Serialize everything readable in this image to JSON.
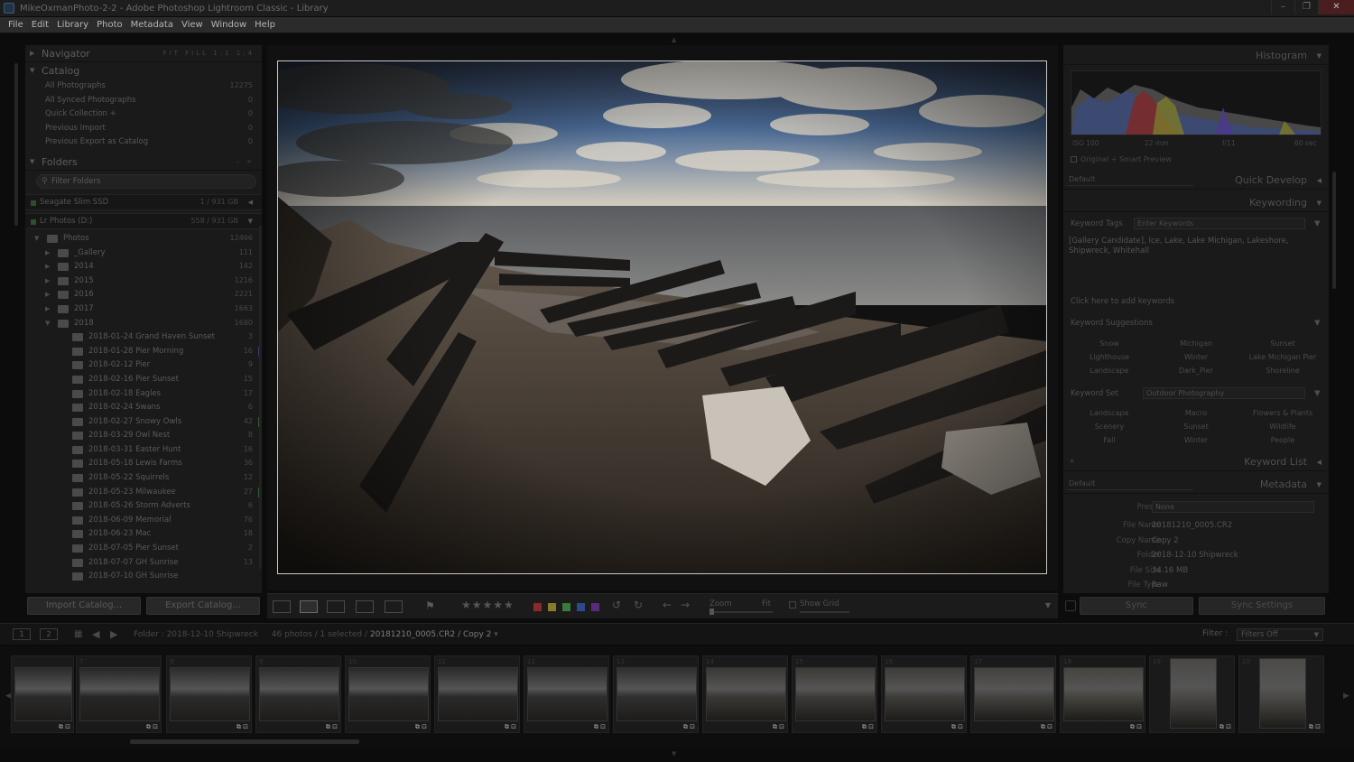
{
  "window": {
    "title": "MikeOxmanPhoto-2-2 - Adobe Photoshop Lightroom Classic - Library",
    "controls": [
      "–",
      "❐",
      "✕"
    ]
  },
  "menu": [
    "File",
    "Edit",
    "Library",
    "Photo",
    "Metadata",
    "View",
    "Window",
    "Help"
  ],
  "left": {
    "navigator": {
      "label": "Navigator",
      "options": "FIT  FILL  1:1  1:4"
    },
    "catalog": {
      "label": "Catalog",
      "items": [
        {
          "label": "All Photographs",
          "count": "12275"
        },
        {
          "label": "All Synced Photographs",
          "count": "0"
        },
        {
          "label": "Quick Collection +",
          "count": "0"
        },
        {
          "label": "Previous Import",
          "count": "0"
        },
        {
          "label": "Previous Export as Catalog",
          "count": "0"
        }
      ]
    },
    "folders": {
      "label": "Folders",
      "filter": "Filter Folders",
      "volume1": {
        "label": "Seagate Slim SSD",
        "cap": "1 / 931 GB"
      },
      "volume2": {
        "label": "Lr Photos (D:)",
        "cap": "558 / 931 GB"
      },
      "tree": [
        {
          "label": "Photos",
          "count": "12466",
          "level": 0,
          "tri": "▼"
        },
        {
          "label": "_Gallery",
          "count": "111",
          "level": 1,
          "tri": "▶"
        },
        {
          "label": "2014",
          "count": "142",
          "level": 1,
          "tri": "▶"
        },
        {
          "label": "2015",
          "count": "1216",
          "level": 1,
          "tri": "▶"
        },
        {
          "label": "2016",
          "count": "2221",
          "level": 1,
          "tri": "▶"
        },
        {
          "label": "2017",
          "count": "1663",
          "level": 1,
          "tri": "▶"
        },
        {
          "label": "2018",
          "count": "1680",
          "level": 1,
          "tri": "▼"
        },
        {
          "label": "2018-01-24 Grand Haven Sunset",
          "count": "3",
          "level": 2,
          "mark": ""
        },
        {
          "label": "2018-01-28 Pier Morning",
          "count": "16",
          "level": 2,
          "mark": "#3a3a6a"
        },
        {
          "label": "2018-02-12 Pier",
          "count": "9",
          "level": 2,
          "mark": ""
        },
        {
          "label": "2018-02-16 Pier Sunset",
          "count": "15",
          "level": 2,
          "mark": ""
        },
        {
          "label": "2018-02-18 Eagles",
          "count": "17",
          "level": 2,
          "mark": ""
        },
        {
          "label": "2018-02-24 Swans",
          "count": "6",
          "level": 2,
          "mark": ""
        },
        {
          "label": "2018-02-27 Snowy Owls",
          "count": "42",
          "level": 2,
          "mark": "#3a5a3a"
        },
        {
          "label": "2018-03-29 Owl Nest",
          "count": "8",
          "level": 2,
          "mark": ""
        },
        {
          "label": "2018-03-31 Easter Hunt",
          "count": "16",
          "level": 2,
          "mark": ""
        },
        {
          "label": "2018-05-18 Lewis Farms",
          "count": "36",
          "level": 2,
          "mark": ""
        },
        {
          "label": "2018-05-22 Squirrels",
          "count": "12",
          "level": 2,
          "mark": ""
        },
        {
          "label": "2018-05-23 Milwaukee",
          "count": "27",
          "level": 2,
          "mark": "#3a5a3a"
        },
        {
          "label": "2018-05-26 Storm Adverts",
          "count": "6",
          "level": 2,
          "mark": ""
        },
        {
          "label": "2018-06-09 Memorial",
          "count": "76",
          "level": 2,
          "mark": ""
        },
        {
          "label": "2018-06-23 Mac",
          "count": "18",
          "level": 2,
          "mark": ""
        },
        {
          "label": "2018-07-05 Pier Sunset",
          "count": "2",
          "level": 2,
          "mark": ""
        },
        {
          "label": "2018-07-07 GH Sunrise",
          "count": "13",
          "level": 2,
          "mark": ""
        },
        {
          "label": "2018-07-10 GH Sunrise",
          "count": "",
          "level": 2,
          "mark": ""
        }
      ]
    },
    "import_label": "Import Catalog...",
    "export_label": "Export Catalog..."
  },
  "toolbar": {
    "stars": "★★★★★",
    "colors": [
      "#8a2a2a",
      "#8a7a2a",
      "#3a7a3a",
      "#2a4a8a",
      "#5a2a7a"
    ],
    "zoom_label": "Zoom",
    "zoom_value": "Fit",
    "grid_label": "Show Grid"
  },
  "right": {
    "histogram": {
      "label": "Histogram",
      "iso": "ISO 100",
      "focal": "22 mm",
      "aperture": "f/11",
      "shutter": "60 sec",
      "original": "Original + Smart Preview"
    },
    "quick_develop": {
      "label": "Quick Develop",
      "preset": "Default"
    },
    "keywording": {
      "label": "Keywording",
      "tags_label": "Keyword Tags",
      "tags_placeholder": "Enter Keywords",
      "tags": "[Gallery Candidate], Ice, Lake, Lake Michigan, Lakeshore, Shipwreck, Whitehall",
      "click_add": "Click here to add keywords",
      "suggestions_label": "Keyword Suggestions",
      "suggestions": [
        "Snow",
        "Michigan",
        "Sunset",
        "Lighthouse",
        "Winter",
        "Lake Michigan Pier",
        "Landscape",
        "Dark_Pier",
        "Shoreline"
      ],
      "set_label": "Keyword Set",
      "set_value": "Outdoor Photography",
      "set_items": [
        "Landscape",
        "Macro",
        "Flowers & Plants",
        "Scenery",
        "Sunset",
        "Wildlife",
        "Fall",
        "Winter",
        "People"
      ]
    },
    "keyword_list": {
      "label": "Keyword List",
      "plus": "+"
    },
    "metadata": {
      "label": "Metadata",
      "preset_sel": "Default",
      "preset_label": "Preset",
      "preset_value": "None",
      "rows": [
        {
          "key": "File Name",
          "value": "20181210_0005.CR2"
        },
        {
          "key": "Copy Name",
          "value": "Copy 2"
        },
        {
          "key": "Folder",
          "value": "2018-12-10 Shipwreck"
        },
        {
          "key": "File Size",
          "value": "34.16 MB"
        },
        {
          "key": "File Type",
          "value": "Raw"
        }
      ]
    },
    "sync_label": "Sync",
    "sync_settings_label": "Sync Settings"
  },
  "filmstrip": {
    "monitor1": "1",
    "monitor2": "2",
    "path_prefix": "Folder : 2018-12-10 Shipwreck",
    "path_count": "46 photos / 1 selected /",
    "path_file": "20181210_0005.CR2 / Copy 2",
    "path_caret": "▾",
    "filter_label": "Filter :",
    "filter_value": "Filters Off",
    "thumbs": [
      "",
      "7",
      "8",
      "9",
      "10",
      "11",
      "12",
      "13",
      "14",
      "15",
      "16",
      "17",
      "18",
      "19",
      "20"
    ]
  }
}
